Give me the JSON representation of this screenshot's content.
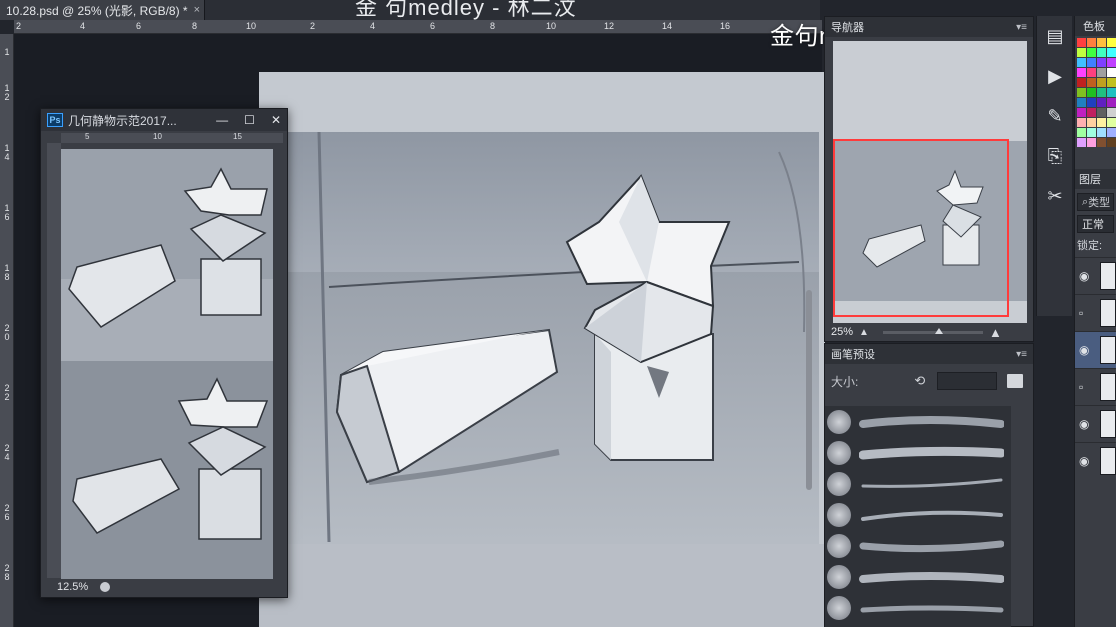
{
  "document_tab": {
    "title": "10.28.psd @ 25% (光影, RGB/8) *",
    "close_glyph": "×"
  },
  "top_title_cut": "金 句medley - 林二汶",
  "watermark": "金句medley-林二汶",
  "ruler_top_ticks": [
    "2",
    "4",
    "6",
    "8",
    "10",
    "12",
    "14",
    "16",
    "2",
    "4",
    "6",
    "8",
    "10",
    "12",
    "14",
    "16"
  ],
  "ruler_left_ticks": [
    "1",
    "1 2",
    "1 4",
    "1 6",
    "1 8",
    "2 0",
    "2 2",
    "2 4",
    "2 6",
    "2 8"
  ],
  "reference_window": {
    "badge": "Ps",
    "title": "几何静物示范2017...",
    "controls": [
      "—",
      "☐",
      "✕"
    ],
    "zoom": "12.5%",
    "ruler_ticks": [
      "5",
      "10",
      "15"
    ]
  },
  "navigator": {
    "title": "导航器",
    "zoom": "25%",
    "menu_glyph": "▾≡"
  },
  "brush_presets": {
    "title": "画笔预设",
    "size_label": "大小:",
    "reset_glyph": "⟲",
    "menu_glyph": "▾≡"
  },
  "swatches": {
    "title": "色板",
    "colors": [
      "#ff4040",
      "#ff7f3f",
      "#ffbf3f",
      "#ffff40",
      "#bfff40",
      "#40ff40",
      "#40ffbf",
      "#40ffff",
      "#40bfff",
      "#407fff",
      "#7f40ff",
      "#bf40ff",
      "#ff40ff",
      "#ff407f",
      "#a0a0a0",
      "#ffffff",
      "#c02020",
      "#c06020",
      "#c0a020",
      "#c0c020",
      "#80c020",
      "#20c020",
      "#20c080",
      "#20c0c0",
      "#2080c0",
      "#2040c0",
      "#6020c0",
      "#a020c0",
      "#c020c0",
      "#c02060",
      "#606060",
      "#d0d0d0",
      "#ffb0b0",
      "#ffd0a0",
      "#fff0a0",
      "#e0ffa0",
      "#a0ffa0",
      "#a0ffe0",
      "#a0e0ff",
      "#a0b0ff",
      "#e0a0ff",
      "#ffa0e0",
      "#805030",
      "#604020"
    ]
  },
  "layers": {
    "title": "图层",
    "search_placeholder": "类型",
    "blend_mode": "正常",
    "lock_label": "锁定:"
  },
  "tools": [
    "history-icon",
    "play-icon",
    "brush-tool-icon",
    "clone-icon",
    "tools-icon"
  ],
  "colors": {
    "accent_frame": "#ff3b3b",
    "panel_bg": "#3a3d44",
    "canvas_bg": "#9ea6b1"
  }
}
